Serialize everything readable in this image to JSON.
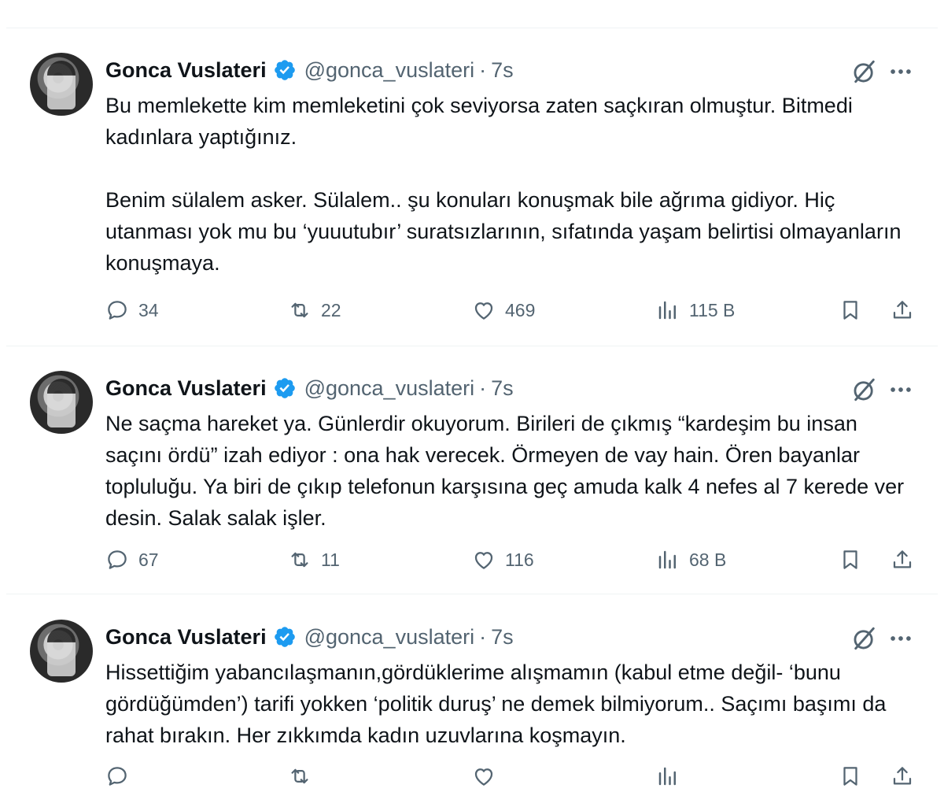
{
  "tweets": [
    {
      "name": "Gonca Vuslateri",
      "handle": "@gonca_vuslateri",
      "dot": "·",
      "time": "7s",
      "paragraphs": [
        "Bu memlekette kim memleketini çok seviyorsa zaten saçkıran olmuştur. Bitmedi kadınlara yaptığınız.",
        "Benim sülalem asker. Sülalem.. şu konuları konuşmak bile ağrıma gidiyor. Hiç utanması yok mu bu  ‘yuuutubır’ suratsızlarının, sıfatında yaşam belirtisi olmayanların konuşmaya."
      ],
      "replies": "34",
      "retweets": "22",
      "likes": "469",
      "views": "115 B"
    },
    {
      "name": "Gonca Vuslateri",
      "handle": "@gonca_vuslateri",
      "dot": "·",
      "time": "7s",
      "paragraphs": [
        "Ne saçma hareket ya. Günlerdir okuyorum. Birileri de çıkmış “kardeşim bu insan saçını ördü” izah ediyor : ona hak verecek. Örmeyen de vay hain. Ören bayanlar topluluğu. Ya biri de çıkıp telefonun karşısına geç amuda kalk 4 nefes al 7 kerede ver desin. Salak salak işler."
      ],
      "replies": "67",
      "retweets": "11",
      "likes": "116",
      "views": "68 B"
    },
    {
      "name": "Gonca Vuslateri",
      "handle": "@gonca_vuslateri",
      "dot": "·",
      "time": "7s",
      "paragraphs": [
        "Hissettiğim yabancılaşmanın,gördüklerime alışmamın (kabul etme değil- ‘bunu gördüğümden’) tarifi yokken ‘politik duruş’ ne demek bilmiyorum.. Saçımı başımı da rahat bırakın. Her zıkkımda kadın uzuvlarına koşmayın."
      ]
    }
  ],
  "icons": {
    "verified": "verified-badge-icon",
    "grok": "grok-icon",
    "more": "more-icon",
    "reply": "reply-icon",
    "retweet": "retweet-icon",
    "like": "heart-icon",
    "views": "views-icon",
    "bookmark": "bookmark-icon",
    "share": "share-icon"
  },
  "colors": {
    "verified": "#1d9bf0",
    "secondary_text": "#536471",
    "primary_text": "#0f1419",
    "divider": "#eff3f4"
  }
}
